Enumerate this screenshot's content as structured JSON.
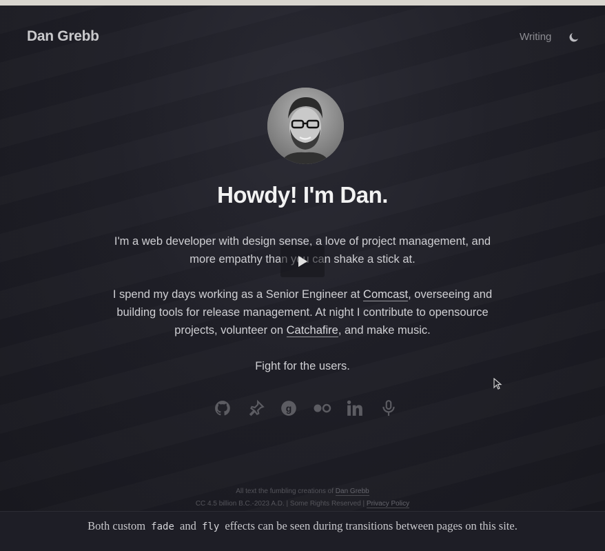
{
  "header": {
    "logo": "Dan Grebb",
    "nav_writing": "Writing",
    "theme_toggle_icon": "moon-icon"
  },
  "hero": {
    "headline": "Howdy! I'm Dan.",
    "intro": "I'm a web developer with design sense, a love of project management, and more empathy than you can shake a stick at.",
    "work_pre": "I spend my days working as a Senior Engineer at ",
    "work_link1": "Comcast",
    "work_mid": ", overseeing and building tools for release management. At night I contribute to opensource projects, volunteer on ",
    "work_link2": "Catchafire",
    "work_post": ", and make music.",
    "motto": "Fight for the users."
  },
  "socials": [
    "github-icon",
    "pin-icon",
    "goodreads-icon",
    "flickr-icon",
    "linkedin-icon",
    "podcast-icon"
  ],
  "footer": {
    "line1_pre": "All text the fumbling creations of ",
    "line1_link": "Dan Grebb",
    "line2_pre": "CC 4.5 billion B.C.-2023 A.D. | Some Rights Reserved | ",
    "line2_link": "Privacy Policy"
  },
  "caption": {
    "pre": "Both custom",
    "code1": "fade",
    "mid": "and",
    "code2": "fly",
    "post": "effects can be seen during transitions between pages on this site."
  },
  "colors": {
    "background": "#1b1b22",
    "text": "#cfcfd3",
    "headline": "#f2f2f2",
    "top_bar": "#d9d6cf"
  }
}
